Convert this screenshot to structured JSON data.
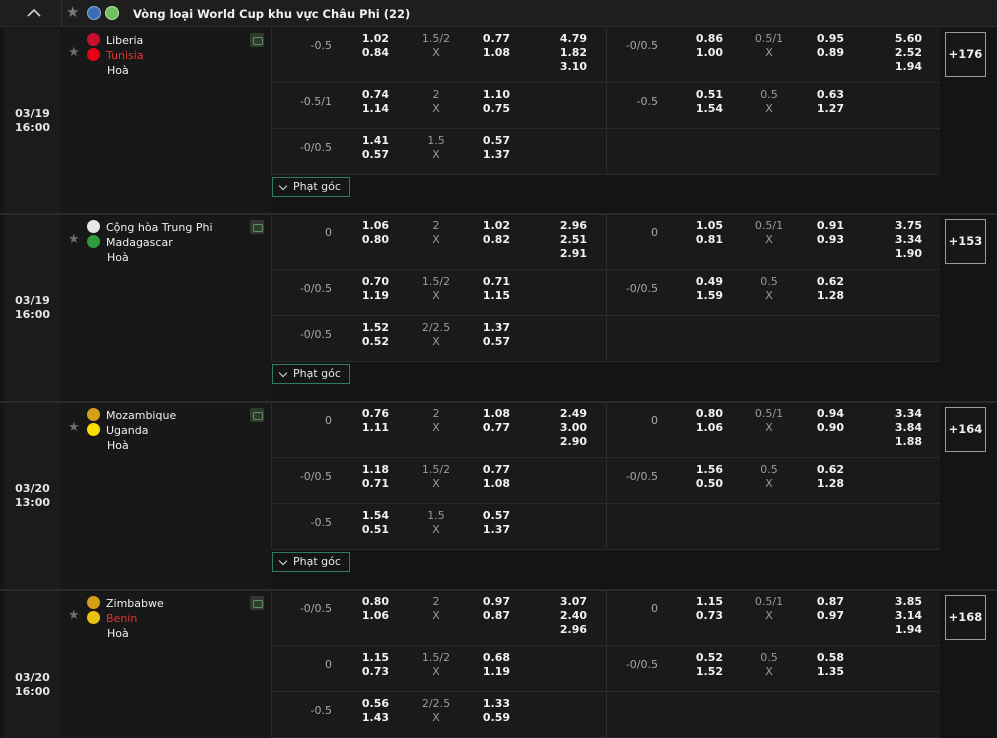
{
  "league": {
    "title": "Vòng loại World Cup khu vực Châu Phi (22)"
  },
  "corner_label": "Phạt góc",
  "matches": [
    {
      "date": "03/19",
      "time": "16:00",
      "home": "Liberia",
      "away": "Tunisia",
      "away_red": true,
      "draw_label": "Hoà",
      "home_flag_color": "#c8102e",
      "away_flag_color": "#e70013",
      "more": "+176",
      "rows": [
        {
          "h1": "-0.5",
          "o1a": "1.02",
          "o1b": "0.84",
          "ou1": "1.5/2",
          "x1": "X",
          "u1a": "0.77",
          "u1b": "1.08",
          "m1": "4.79\n1.82\n3.10",
          "h2": "-0/0.5",
          "o2a": "0.86",
          "o2b": "1.00",
          "ou2": "0.5/1",
          "x2": "X",
          "u2a": "0.95",
          "u2b": "0.89",
          "m2": "5.60\n2.52\n1.94"
        },
        {
          "h1": "-0.5/1",
          "o1a": "0.74",
          "o1b": "1.14",
          "ou1": "2",
          "x1": "X",
          "u1a": "1.10",
          "u1b": "0.75",
          "m1": "",
          "h2": "-0.5",
          "o2a": "0.51",
          "o2b": "1.54",
          "ou2": "0.5",
          "x2": "X",
          "u2a": "0.63",
          "u2b": "1.27",
          "m2": ""
        },
        {
          "h1": "-0/0.5",
          "o1a": "1.41",
          "o1b": "0.57",
          "ou1": "1.5",
          "x1": "X",
          "u1a": "0.57",
          "u1b": "1.37",
          "m1": "",
          "h2": "",
          "o2a": "",
          "o2b": "",
          "ou2": "",
          "x2": "",
          "u2a": "",
          "u2b": "",
          "m2": ""
        }
      ]
    },
    {
      "date": "03/19",
      "time": "16:00",
      "home": "Cộng hòa Trung Phi",
      "away": "Madagascar",
      "away_red": false,
      "draw_label": "Hoà",
      "home_flag_color": "#e8e8e8",
      "away_flag_color": "#2e9b3c",
      "more": "+153",
      "rows": [
        {
          "h1": "0",
          "o1a": "1.06",
          "o1b": "0.80",
          "ou1": "2",
          "x1": "X",
          "u1a": "1.02",
          "u1b": "0.82",
          "m1": "2.96\n2.51\n2.91",
          "h2": "0",
          "o2a": "1.05",
          "o2b": "0.81",
          "ou2": "0.5/1",
          "x2": "X",
          "u2a": "0.91",
          "u2b": "0.93",
          "m2": "3.75\n3.34\n1.90"
        },
        {
          "h1": "-0/0.5",
          "o1a": "0.70",
          "o1b": "1.19",
          "ou1": "1.5/2",
          "x1": "X",
          "u1a": "0.71",
          "u1b": "1.15",
          "m1": "",
          "h2": "-0/0.5",
          "o2a": "0.49",
          "o2b": "1.59",
          "ou2": "0.5",
          "x2": "X",
          "u2a": "0.62",
          "u2b": "1.28",
          "m2": ""
        },
        {
          "h1": "-0/0.5",
          "o1a": "1.52",
          "o1b": "0.52",
          "ou1": "2/2.5",
          "x1": "X",
          "u1a": "1.37",
          "u1b": "0.57",
          "m1": "",
          "h2": "",
          "o2a": "",
          "o2b": "",
          "ou2": "",
          "x2": "",
          "u2a": "",
          "u2b": "",
          "m2": ""
        }
      ]
    },
    {
      "date": "03/20",
      "time": "13:00",
      "home": "Mozambique",
      "away": "Uganda",
      "away_red": false,
      "draw_label": "Hoà",
      "home_flag_color": "#d4a017",
      "away_flag_color": "#fcdc04",
      "more": "+164",
      "rows": [
        {
          "h1": "0",
          "o1a": "0.76",
          "o1b": "1.11",
          "ou1": "2",
          "x1": "X",
          "u1a": "1.08",
          "u1b": "0.77",
          "m1": "2.49\n3.00\n2.90",
          "h2": "0",
          "o2a": "0.80",
          "o2b": "1.06",
          "ou2": "0.5/1",
          "x2": "X",
          "u2a": "0.94",
          "u2b": "0.90",
          "m2": "3.34\n3.84\n1.88"
        },
        {
          "h1": "-0/0.5",
          "o1a": "1.18",
          "o1b": "0.71",
          "ou1": "1.5/2",
          "x1": "X",
          "u1a": "0.77",
          "u1b": "1.08",
          "m1": "",
          "h2": "-0/0.5",
          "o2a": "1.56",
          "o2b": "0.50",
          "ou2": "0.5",
          "x2": "X",
          "u2a": "0.62",
          "u2b": "1.28",
          "m2": ""
        },
        {
          "h1": "-0.5",
          "o1a": "1.54",
          "o1b": "0.51",
          "ou1": "1.5",
          "x1": "X",
          "u1a": "0.57",
          "u1b": "1.37",
          "m1": "",
          "h2": "",
          "o2a": "",
          "o2b": "",
          "ou2": "",
          "x2": "",
          "u2a": "",
          "u2b": "",
          "m2": ""
        }
      ]
    },
    {
      "date": "03/20",
      "time": "16:00",
      "home": "Zimbabwe",
      "away": "Benin",
      "away_red": true,
      "draw_label": "Hoà",
      "home_flag_color": "#d4a017",
      "away_flag_color": "#e8c20c",
      "more": "+168",
      "rows": [
        {
          "h1": "-0/0.5",
          "o1a": "0.80",
          "o1b": "1.06",
          "ou1": "2",
          "x1": "X",
          "u1a": "0.97",
          "u1b": "0.87",
          "m1": "3.07\n2.40\n2.96",
          "h2": "0",
          "o2a": "1.15",
          "o2b": "0.73",
          "ou2": "0.5/1",
          "x2": "X",
          "u2a": "0.87",
          "u2b": "0.97",
          "m2": "3.85\n3.14\n1.94"
        },
        {
          "h1": "0",
          "o1a": "1.15",
          "o1b": "0.73",
          "ou1": "1.5/2",
          "x1": "X",
          "u1a": "0.68",
          "u1b": "1.19",
          "m1": "",
          "h2": "-0/0.5",
          "o2a": "0.52",
          "o2b": "1.52",
          "ou2": "0.5",
          "x2": "X",
          "u2a": "0.58",
          "u2b": "1.35",
          "m2": ""
        },
        {
          "h1": "-0.5",
          "o1a": "0.56",
          "o1b": "1.43",
          "ou1": "2/2.5",
          "x1": "X",
          "u1a": "1.33",
          "u1b": "0.59",
          "m1": "",
          "h2": "",
          "o2a": "",
          "o2b": "",
          "ou2": "",
          "x2": "",
          "u2a": "",
          "u2b": "",
          "m2": ""
        }
      ]
    }
  ]
}
